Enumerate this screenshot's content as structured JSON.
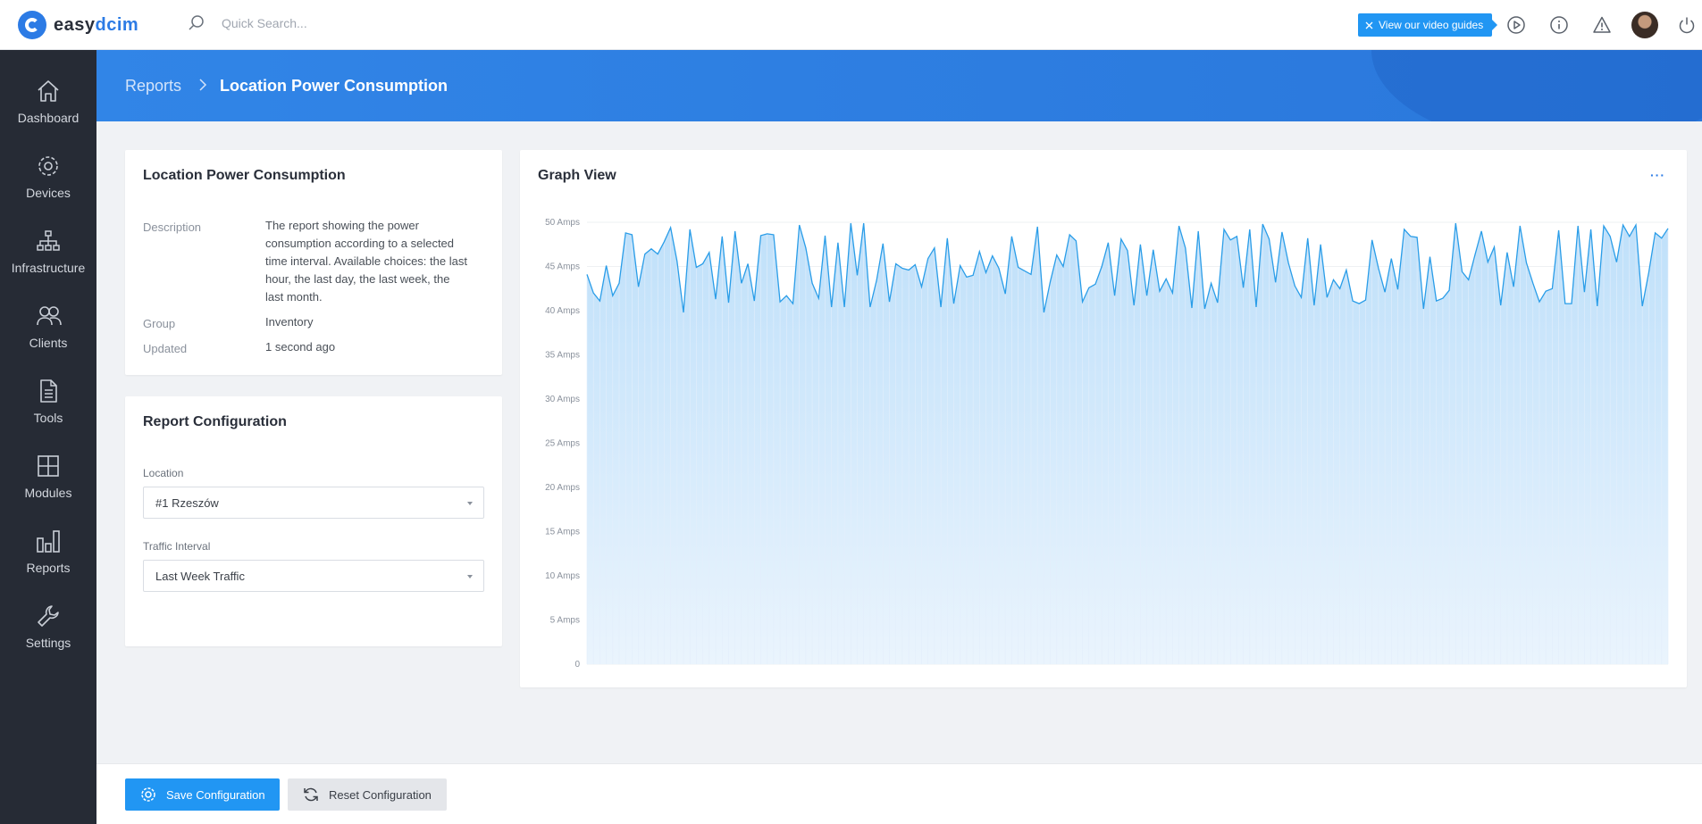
{
  "brand": {
    "name_prefix": "easy",
    "name_suffix": "dcim"
  },
  "topbar": {
    "search_placeholder": "Quick Search...",
    "video_guides_label": "View our video guides",
    "icons": [
      "play-circle-icon",
      "info-icon",
      "warning-icon",
      "avatar",
      "power-icon"
    ]
  },
  "sidebar": {
    "items": [
      {
        "label": "Dashboard",
        "icon": "home-icon"
      },
      {
        "label": "Devices",
        "icon": "gear-icon"
      },
      {
        "label": "Infrastructure",
        "icon": "sitemap-icon"
      },
      {
        "label": "Clients",
        "icon": "users-icon"
      },
      {
        "label": "Tools",
        "icon": "document-icon"
      },
      {
        "label": "Modules",
        "icon": "grid-icon"
      },
      {
        "label": "Reports",
        "icon": "bar-chart-icon"
      },
      {
        "label": "Settings",
        "icon": "wrench-icon"
      }
    ]
  },
  "breadcrumb": {
    "parent": "Reports",
    "current": "Location Power Consumption"
  },
  "info_card": {
    "title": "Location Power Consumption",
    "description_label": "Description",
    "description_value": "The report showing the power consumption according to a selected time interval. Available choices: the last hour, the last day, the last week, the last month.",
    "group_label": "Group",
    "group_value": "Inventory",
    "updated_label": "Updated",
    "updated_value": "1 second ago"
  },
  "config_card": {
    "title": "Report Configuration",
    "location_label": "Location",
    "location_value": "#1 Rzeszów",
    "interval_label": "Traffic Interval",
    "interval_value": "Last Week Traffic"
  },
  "graph_card": {
    "title": "Graph View",
    "menu_label": "···"
  },
  "footer": {
    "save_label": "Save Configuration",
    "reset_label": "Reset Configuration"
  },
  "colors": {
    "accent": "#2196f3",
    "line": "#2a9de8",
    "fill": "#cfe6fb",
    "sidebar": "#262b35",
    "header": "#3185e7"
  },
  "chart_data": {
    "type": "area",
    "ylim": [
      0,
      50
    ],
    "yticks": [
      "0",
      "5 Amps",
      "10 Amps",
      "15 Amps",
      "20 Amps",
      "25 Amps",
      "30 Amps",
      "35 Amps",
      "40 Amps",
      "45 Amps",
      "50 Amps"
    ],
    "unit": "Amps",
    "values": [
      44.1,
      42.0,
      41.1,
      45.1,
      41.7,
      43.1,
      48.8,
      48.6,
      42.7,
      46.4,
      47.0,
      46.4,
      47.8,
      49.4,
      45.6,
      39.8,
      49.2,
      44.9,
      45.3,
      46.6,
      41.3,
      48.4,
      40.9,
      49.0,
      43.1,
      45.3,
      41.1,
      48.5,
      48.7,
      48.6,
      41.0,
      41.7,
      40.8,
      49.7,
      47.1,
      43.1,
      41.4,
      48.5,
      40.4,
      47.7,
      40.4,
      49.9,
      44.0,
      49.9,
      40.4,
      43.4,
      47.6,
      41.0,
      45.3,
      44.8,
      44.6,
      45.2,
      42.7,
      45.9,
      47.1,
      40.4,
      48.2,
      40.8,
      45.1,
      43.8,
      44.0,
      46.7,
      44.3,
      46.2,
      44.8,
      41.9,
      48.4,
      44.9,
      44.5,
      44.1,
      49.5,
      39.8,
      43.3,
      46.3,
      45.0,
      48.6,
      47.9,
      41.0,
      42.6,
      43.0,
      45.0,
      47.7,
      41.7,
      48.1,
      46.8,
      40.6,
      47.5,
      41.7,
      46.9,
      42.2,
      43.6,
      42.0,
      49.6,
      47.1,
      40.3,
      49.0,
      40.2,
      43.1,
      40.9,
      49.2,
      48.0,
      48.4,
      42.6,
      49.2,
      40.4,
      49.8,
      48.1,
      43.2,
      48.9,
      45.4,
      42.8,
      41.5,
      48.2,
      40.6,
      47.5,
      41.5,
      43.5,
      42.5,
      44.6,
      41.1,
      40.8,
      41.2,
      48.0,
      44.8,
      42.1,
      45.9,
      42.4,
      49.2,
      48.4,
      48.3,
      40.2,
      46.1,
      41.1,
      41.4,
      42.3,
      49.9,
      44.4,
      43.5,
      46.3,
      49.0,
      45.5,
      47.2,
      40.6,
      46.6,
      42.7,
      49.6,
      45.4,
      43.1,
      41.0,
      42.2,
      42.5,
      49.1,
      40.8,
      40.8,
      49.6,
      42.1,
      49.2,
      40.5,
      49.6,
      48.4,
      45.5,
      49.7,
      48.4,
      49.7,
      40.5,
      44.3,
      48.8,
      48.2,
      49.3
    ]
  }
}
